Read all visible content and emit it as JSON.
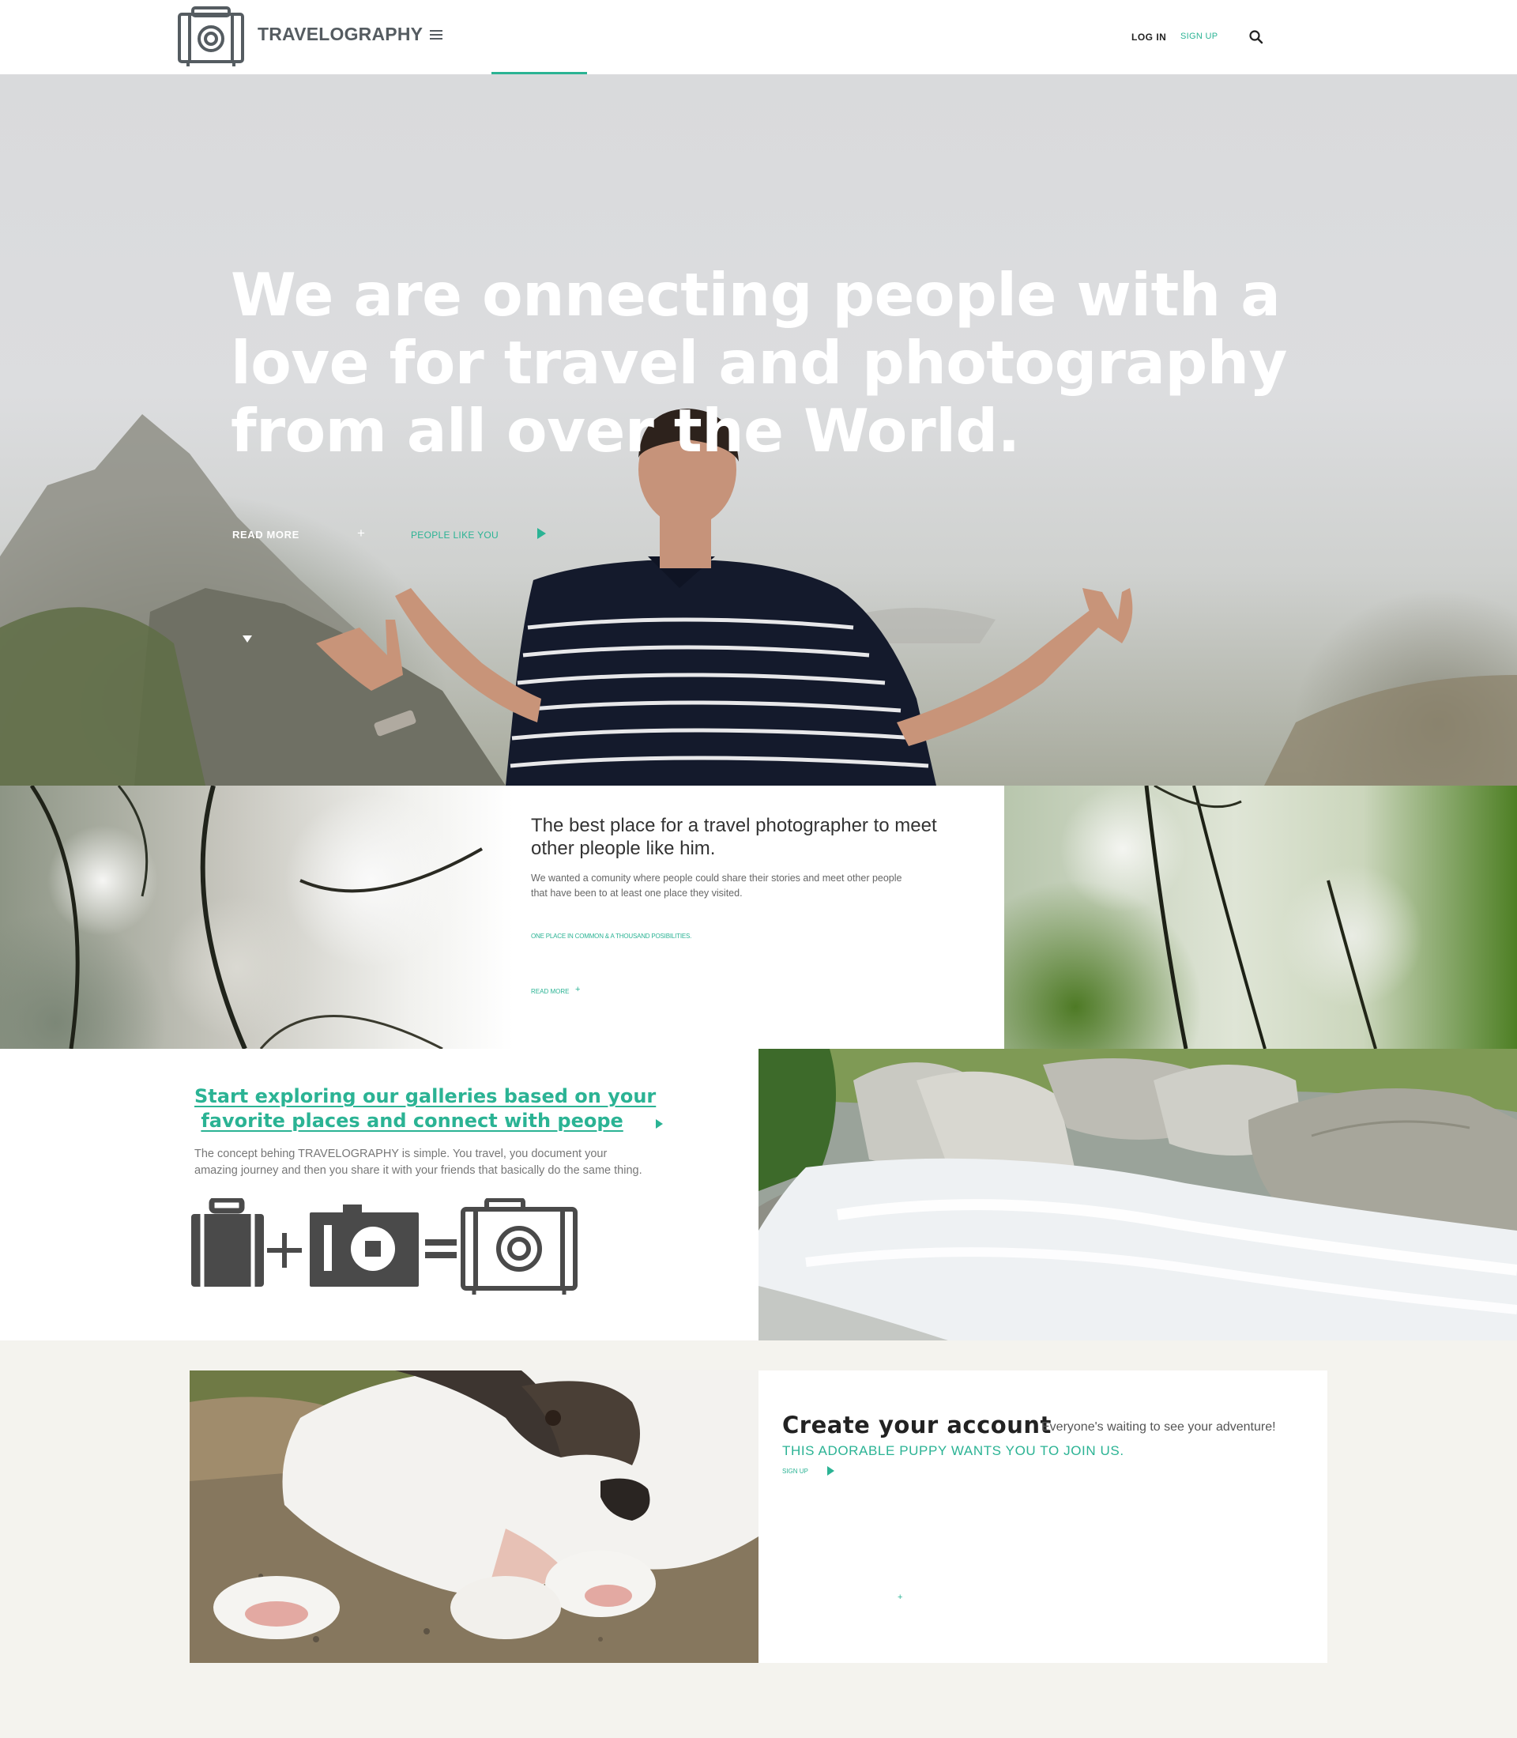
{
  "header": {
    "brand": "TRAVELOGRAPHY",
    "login": "LOG IN",
    "signup": "SIGN UP"
  },
  "hero": {
    "title": "We are onnecting people with a love for travel and photography from all over the World.",
    "read_more": "READ MORE",
    "plus": "+",
    "people_like_you": "PEOPLE LIKE YOU"
  },
  "intro": {
    "title": "The best place for a travel photographer to meet other pleople like him.",
    "description": "We wanted a comunity where people could share their stories and meet other people that have been to at least one place they visited.",
    "tagline": "ONE PLACE IN COMMON & A THOUSAND POSIBILITIES.",
    "read_more": "READ MORE",
    "plus": "+"
  },
  "explore": {
    "title_line1": "Start exploring our galleries based on your",
    "title_line2": "favorite places and connect with peope",
    "description": "The concept behing TRAVELOGRAPHY is simple. You travel, you document your amazing journey and then you share it with your friends that basically do the same thing."
  },
  "account": {
    "title": "Create your account",
    "subtitle": "Everyone's waiting to see your adventure!",
    "puppy_line": "THIS ADORABLE PUPPY WANTS YOU TO JOIN US.",
    "signup": "SIGN UP",
    "plus": "+"
  },
  "colors": {
    "accent": "#2bb394",
    "logo_gray": "#555c61",
    "icon_dark": "#4a4a4a",
    "page_bg": "#f4f3ee"
  },
  "icons": [
    "logo-camera-suitcase-icon",
    "menu-icon",
    "search-icon",
    "play-icon",
    "chevron-down-icon",
    "suitcase-icon",
    "plus-icon",
    "camera-icon",
    "equals-icon",
    "travel-camera-icon"
  ]
}
